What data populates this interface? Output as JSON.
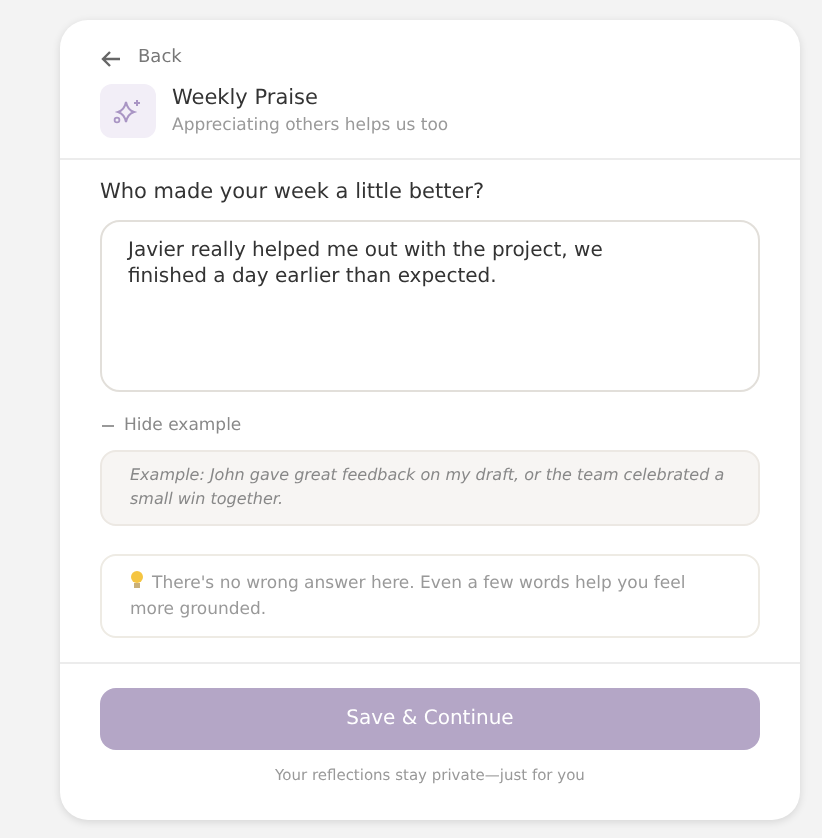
{
  "back": {
    "label": "Back"
  },
  "header": {
    "title": "Weekly Praise",
    "subtitle": "Appreciating others helps us too"
  },
  "question": {
    "label": "Who made your week a little better?",
    "value": "Javier really helped me out with the project, we finished a day earlier than expected."
  },
  "example": {
    "toggle_label": "Hide example",
    "expanded": true,
    "text": "Example: John gave great feedback on my draft, or the team celebrated a small win together."
  },
  "tip": {
    "text": "There's no wrong answer here. Even a few words help you feel more grounded."
  },
  "footer": {
    "button": "Save & Continue",
    "note": "Your reflections stay private—just for you"
  }
}
